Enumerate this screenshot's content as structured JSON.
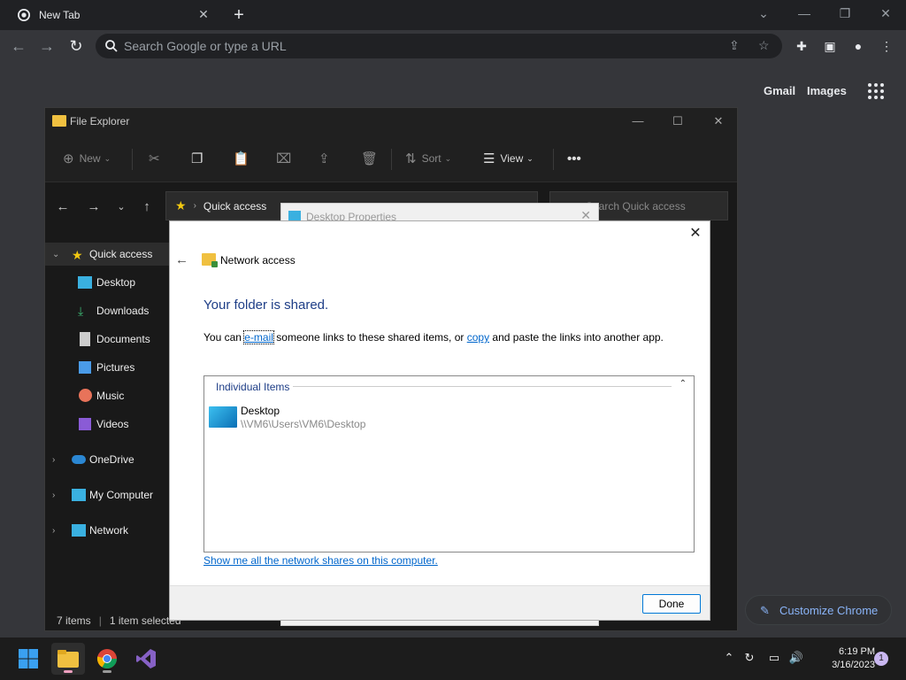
{
  "chrome": {
    "tab_title": "New Tab",
    "omnibox_placeholder": "Search Google or type a URL",
    "ntp_links": [
      "Gmail",
      "Images"
    ],
    "customize_label": "Customize Chrome"
  },
  "explorer": {
    "title": "File Explorer",
    "commands": {
      "new": "New",
      "sort": "Sort",
      "view": "View"
    },
    "address": "Quick access",
    "search_placeholder": "Search Quick access",
    "sidebar": [
      {
        "label": "Quick access",
        "icon": "star-icon"
      },
      {
        "label": "Desktop",
        "icon": "desktop-icon"
      },
      {
        "label": "Downloads",
        "icon": "download-icon"
      },
      {
        "label": "Documents",
        "icon": "documents-icon"
      },
      {
        "label": "Pictures",
        "icon": "pictures-icon"
      },
      {
        "label": "Music",
        "icon": "music-icon"
      },
      {
        "label": "Videos",
        "icon": "videos-icon"
      },
      {
        "label": "OneDrive",
        "icon": "cloud-icon"
      },
      {
        "label": "My Computer",
        "icon": "computer-icon"
      },
      {
        "label": "Network",
        "icon": "network-icon"
      }
    ],
    "status_items": "7 items",
    "status_selected": "1 item selected"
  },
  "properties_dialog": {
    "title": "Desktop Properties"
  },
  "network_dialog": {
    "title": "Network access",
    "heading": "Your folder is shared.",
    "text_before": "You can ",
    "email_link": "e-mail",
    "text_middle": " someone links to these shared items, or ",
    "copy_link": "copy",
    "text_after": " and paste the links into another app.",
    "group_header": "Individual Items",
    "item_name": "Desktop",
    "item_path": "\\\\VM6\\Users\\VM6\\Desktop",
    "show_link": "Show me all the network shares on this computer.",
    "done_label": "Done"
  },
  "taskbar": {
    "time": "6:19 PM",
    "date": "3/16/2023",
    "notification_count": "1"
  },
  "colors": {
    "dialog_heading": "#1e3e87",
    "link": "#0066cc",
    "chrome_accent": "#8ab4f8"
  }
}
